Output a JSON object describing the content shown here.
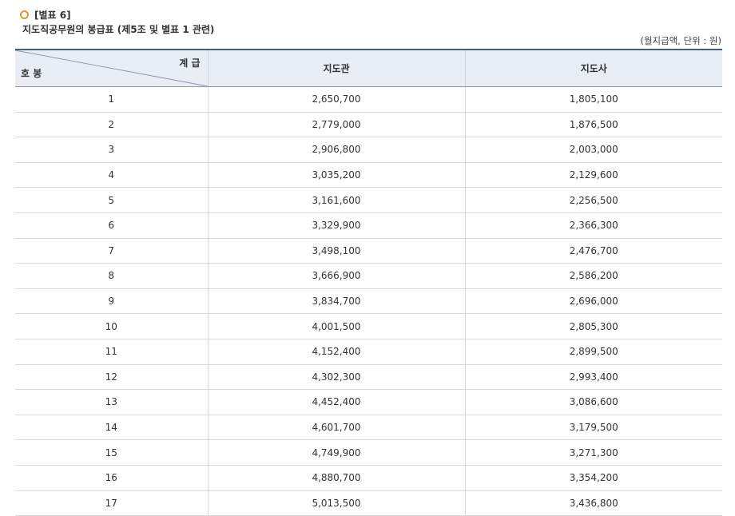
{
  "header": {
    "label": "[별표 6]",
    "title": "지도직공무원의 봉급표 (제5조 및 별표 1 관련)",
    "unit_note": "(월지급액, 단위 : 원)"
  },
  "table": {
    "corner_top": "계 급",
    "corner_bottom": "호 봉",
    "columns": [
      "지도관",
      "지도사"
    ],
    "rows": [
      [
        "1",
        "2,650,700",
        "1,805,100"
      ],
      [
        "2",
        "2,779,000",
        "1,876,500"
      ],
      [
        "3",
        "2,906,800",
        "2,003,000"
      ],
      [
        "4",
        "3,035,200",
        "2,129,600"
      ],
      [
        "5",
        "3,161,600",
        "2,256,500"
      ],
      [
        "6",
        "3,329,900",
        "2,366,300"
      ],
      [
        "7",
        "3,498,100",
        "2,476,700"
      ],
      [
        "8",
        "3,666,900",
        "2,586,200"
      ],
      [
        "9",
        "3,834,700",
        "2,696,000"
      ],
      [
        "10",
        "4,001,500",
        "2,805,300"
      ],
      [
        "11",
        "4,152,400",
        "2,899,500"
      ],
      [
        "12",
        "4,302,300",
        "2,993,400"
      ],
      [
        "13",
        "4,452,400",
        "3,086,600"
      ],
      [
        "14",
        "4,601,700",
        "3,179,500"
      ],
      [
        "15",
        "4,749,900",
        "3,271,300"
      ],
      [
        "16",
        "4,880,700",
        "3,354,200"
      ],
      [
        "17",
        "5,013,500",
        "3,436,800"
      ]
    ]
  },
  "icons": {
    "bullet": "ring-bullet-icon"
  },
  "colors": {
    "bullet": "#e8962f",
    "header_bg": "#e9eef6",
    "top_rule": "#4a5a7a"
  }
}
